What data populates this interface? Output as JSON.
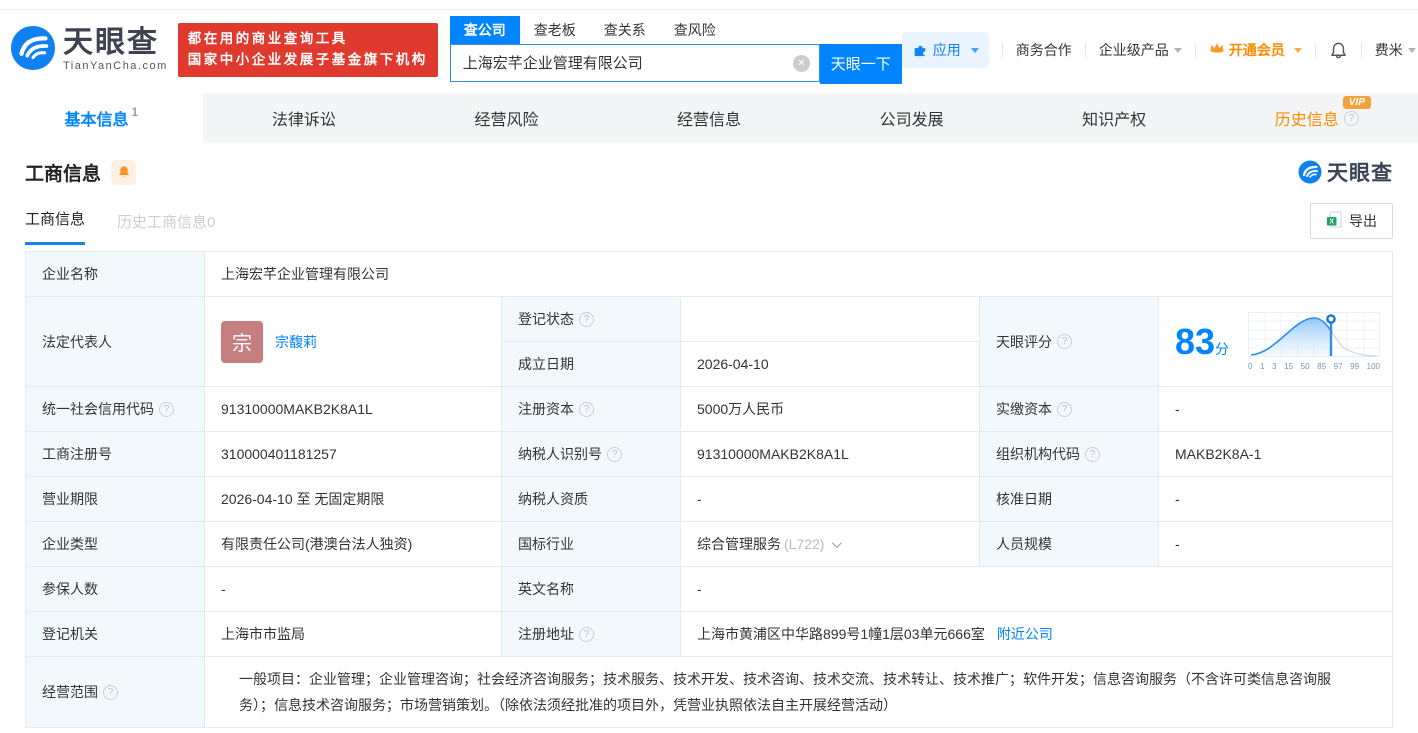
{
  "brand": {
    "logo_text": "天眼查",
    "logo_domain": "TianYanCha.com",
    "slogan_line1": "都在用的商业查询工具",
    "slogan_line2": "国家中小企业发展子基金旗下机构"
  },
  "search": {
    "tabs": {
      "company": "查公司",
      "boss": "查老板",
      "relation": "查关系",
      "risk": "查风险"
    },
    "value": "上海宏芊企业管理有限公司",
    "button_label": "天眼一下"
  },
  "header_nav": {
    "apps_label": "应用",
    "business_coop_label": "商务合作",
    "enterprise_label": "企业级产品",
    "vip_label": "开通会员",
    "username": "费米"
  },
  "nav_tabs": {
    "basic": "基本信息",
    "basic_count": "1",
    "legal": "法律诉讼",
    "risk": "经营风险",
    "operation": "经营信息",
    "development": "公司发展",
    "ip": "知识产权",
    "history": "历史信息",
    "history_vip": "VIP"
  },
  "section": {
    "title": "工商信息",
    "subtab_current": "工商信息",
    "subtab_history": "历史工商信息0",
    "export_label": "导出",
    "watermark": "天眼查"
  },
  "table": {
    "company_name": {
      "label": "企业名称",
      "value": "上海宏芊企业管理有限公司"
    },
    "legal_rep": {
      "label": "法定代表人",
      "avatar_char": "宗",
      "name": "宗馥莉"
    },
    "reg_status": {
      "label": "登记状态",
      "value": ""
    },
    "est_date": {
      "label": "成立日期",
      "value": "2026-04-10"
    },
    "score": {
      "label": "天眼评分",
      "value": "83",
      "unit": "分",
      "ticks": [
        "0",
        "1",
        "3",
        "15",
        "50",
        "85",
        "97",
        "99",
        "100"
      ]
    },
    "credit_code": {
      "label": "统一社会信用代码",
      "value": "91310000MAKB2K8A1L"
    },
    "reg_capital": {
      "label": "注册资本",
      "value": "5000万人民币"
    },
    "paid_capital": {
      "label": "实缴资本",
      "value": "-"
    },
    "reg_number": {
      "label": "工商注册号",
      "value": "310000401181257"
    },
    "taxpayer_id": {
      "label": "纳税人识别号",
      "value": "91310000MAKB2K8A1L"
    },
    "org_code": {
      "label": "组织机构代码",
      "value": "MAKB2K8A-1"
    },
    "business_term": {
      "label": "营业期限",
      "value": "2026-04-10 至 无固定期限"
    },
    "taxpayer_qual": {
      "label": "纳税人资质",
      "value": "-"
    },
    "approval_date": {
      "label": "核准日期",
      "value": "-"
    },
    "company_type": {
      "label": "企业类型",
      "value": "有限责任公司(港澳台法人独资)"
    },
    "industry": {
      "label": "国标行业",
      "value": "综合管理服务",
      "code": "(L722)"
    },
    "staff_size": {
      "label": "人员规模",
      "value": "-"
    },
    "insured_count": {
      "label": "参保人数",
      "value": "-"
    },
    "english_name": {
      "label": "英文名称",
      "value": "-"
    },
    "reg_authority": {
      "label": "登记机关",
      "value": "上海市市监局"
    },
    "reg_address": {
      "label": "注册地址",
      "value": "上海市黄浦区中华路899号1幢1层03单元666室",
      "link": "附近公司"
    },
    "business_scope": {
      "label": "经营范围",
      "value": "一般项目：企业管理；企业管理咨询；社会经济咨询服务；技术服务、技术开发、技术咨询、技术交流、技术转让、技术推广；软件开发；信息咨询服务（不含许可类信息咨询服务）；信息技术咨询服务；市场营销策划。（除依法须经批准的项目外，凭营业执照依法自主开展经营活动）"
    }
  },
  "icons": {
    "help": "?",
    "clear": "✕",
    "excel": "X"
  },
  "colors": {
    "brand_blue": "#0084ff",
    "orange": "#ff8a00",
    "red_banner": "#e0392e",
    "label_bg": "#f2f9fd",
    "border": "#e4eaf0",
    "avatar_bg": "#c67e7e",
    "score_blue": "#0084ff"
  }
}
